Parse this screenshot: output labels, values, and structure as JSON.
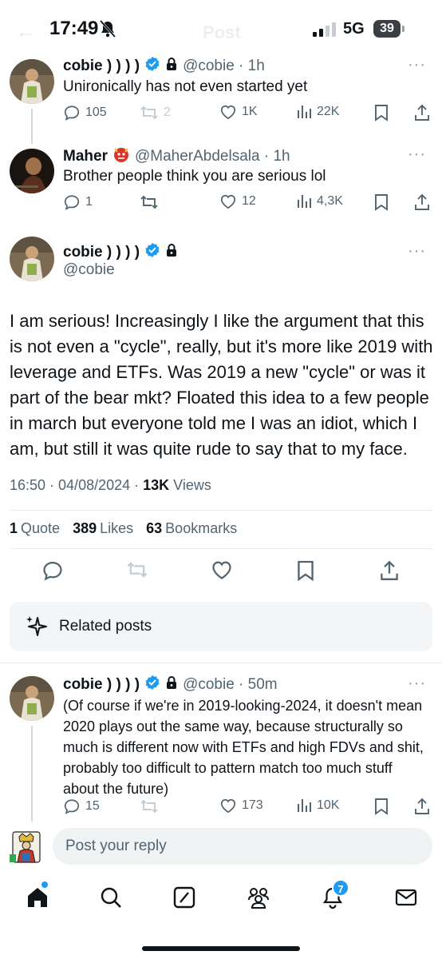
{
  "status_bar": {
    "time": "17:49",
    "network": "5G",
    "battery": "39",
    "header_title": "Post"
  },
  "replies_above": [
    {
      "name": "cobie ) ) ) )",
      "handle": "@cobie",
      "time": "1h",
      "verified": true,
      "protected": true,
      "text": "Unironically has not even started yet",
      "stats": {
        "replies": "105",
        "reposts": "2",
        "likes": "1K",
        "views": "22K"
      }
    },
    {
      "name": "Maher",
      "emoji": "👹",
      "handle": "@MaherAbdelsala",
      "time": "1h",
      "text": "Brother people think you are serious lol",
      "stats": {
        "replies": "1",
        "reposts": "",
        "likes": "12",
        "views": "4,3K"
      }
    }
  ],
  "main_post": {
    "name": "cobie ) ) ) )",
    "handle": "@cobie",
    "verified": true,
    "protected": true,
    "text": "I am serious! Increasingly I like the argument that this is not even a \"cycle\", really, but it's more like 2019 with leverage and ETFs. Was 2019 a new \"cycle\" or was it part of the bear mkt? Floated this idea to a few people in march but everyone told me I was an idiot, which I am, but still it was quite rude to say that to my face.",
    "timestamp": "16:50 · 04/08/2024 · ",
    "views_count": "13K",
    "views_label": " Views",
    "quotes_count": "1",
    "quotes_label": "Quote",
    "likes_count": "389",
    "likes_label": "Likes",
    "bookmarks_count": "63",
    "bookmarks_label": "Bookmarks"
  },
  "related": {
    "label": "Related posts"
  },
  "reply_below": {
    "name": "cobie ) ) ) )",
    "handle": "@cobie",
    "time": "50m",
    "verified": true,
    "protected": true,
    "text": "(Of course if we're in 2019-looking-2024, it doesn't mean 2020 plays out the same way, because structurally so much is different now with ETFs and high FDVs and shit, probably too difficult to pattern match too much stuff about the future)",
    "stats": {
      "replies": "15",
      "reposts": "",
      "likes": "173",
      "views": "10K"
    }
  },
  "composer": {
    "placeholder": "Post your reply"
  },
  "tabbar": {
    "items": [
      "home-tab",
      "search-tab",
      "grok-tab",
      "communities-tab",
      "notifications-tab",
      "messages-tab"
    ],
    "notification_badge": "7"
  },
  "colors": {
    "accent": "#1d9bf0",
    "text": "#0f1419",
    "muted": "#536471"
  }
}
